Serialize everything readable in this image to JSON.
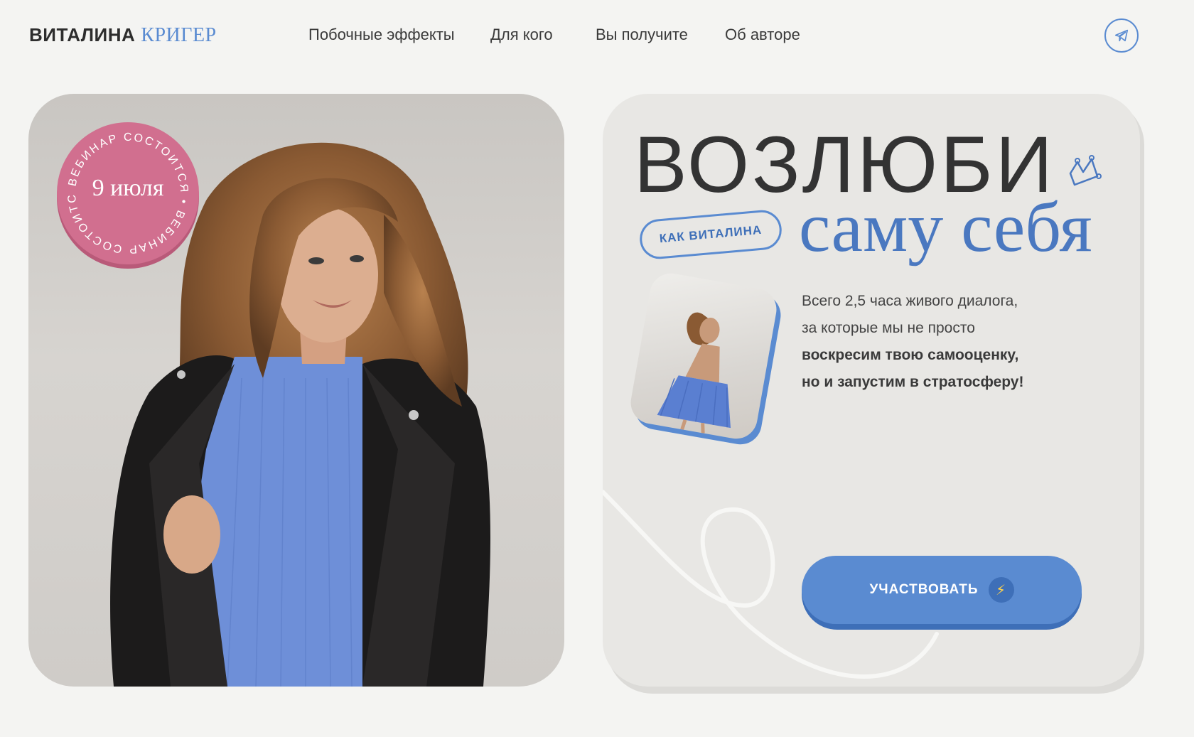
{
  "header": {
    "logo_first": "ВИТАЛИНА",
    "logo_last": "КРИГЕР",
    "nav": [
      {
        "label": "Побочные эффекты"
      },
      {
        "label": "Для кого"
      },
      {
        "label": "Вы получите"
      },
      {
        "label": "Об авторе"
      }
    ],
    "telegram_icon": "telegram-icon"
  },
  "badge": {
    "ring_text": "ВЕБИНАР СОСТОИТСЯ • ВЕБИНАР СОСТОИТСЯ •",
    "date": "9 июля"
  },
  "hero": {
    "headline": "ВОЗЛЮБИ",
    "subheadline": "саму себя",
    "pill": "КАК ВИТАЛИНА",
    "crown_icon": "crown-icon",
    "description": {
      "line1": "Всего 2,5 часа живого диалога,",
      "line2": "за которые мы не просто",
      "line3": "воскресим твою самооценку,",
      "line4": "но и запустим в стратосферу!"
    },
    "cta": {
      "label": "УЧАСТВОВАТЬ",
      "icon": "lightning-icon"
    }
  },
  "colors": {
    "accent_blue": "#5a8bd1",
    "badge_pink": "#d16f8f",
    "background": "#f4f4f2",
    "card_bg": "#e8e7e4"
  }
}
